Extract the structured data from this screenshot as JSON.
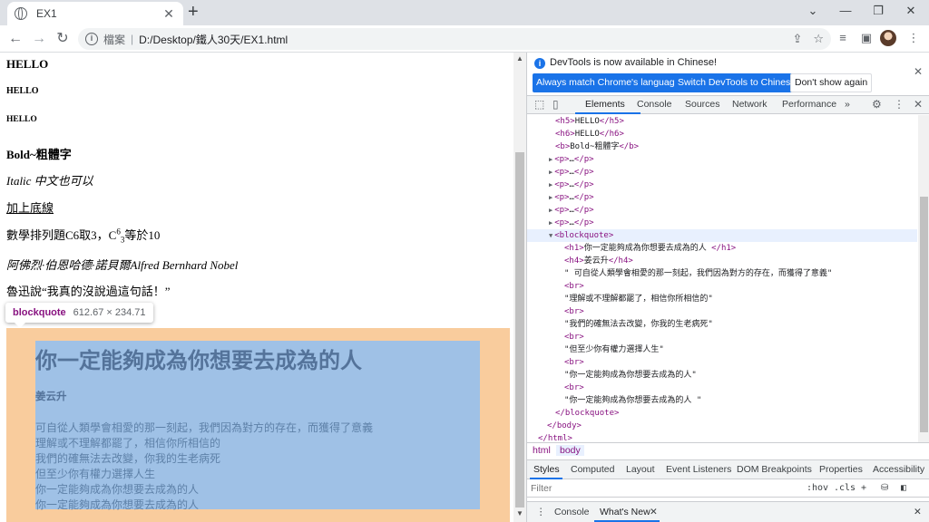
{
  "browser": {
    "tab_title": "EX1",
    "tab_close": "✕",
    "new_tab": "+",
    "window_controls": [
      "⌄",
      "—",
      "❐",
      "✕"
    ],
    "nav": {
      "back": "←",
      "forward": "→",
      "reload": "↻"
    },
    "scheme_label": "檔案",
    "url": "D:/Desktop/鐵人30天/EX1.html",
    "icons": [
      "share-icon",
      "star-icon",
      "reading-list-icon",
      "side-panel-icon",
      "profile-avatar",
      "menu-icon"
    ]
  },
  "page": {
    "h5": "HELLO",
    "h6a": "HELLO",
    "h6b": "HELLO",
    "bold": "Bold~粗體字",
    "italic": "Italic 中文也可以",
    "underline": "加上底線",
    "math": {
      "prefix": "數學排列題C6取3，C",
      "sup": "6",
      "sub": "3",
      "suffix": "等於10"
    },
    "names": "阿佛烈·伯恩哈德·諾貝爾Alfred Bernhard Nobel",
    "quote": "魯迅說“我真的沒說過這句話！”",
    "tooltip": {
      "tag": "blockquote",
      "dims": "612.67 × 234.71"
    },
    "blockquote": {
      "h1": "你一定能夠成為你想要去成為的人",
      "h4": "姜云升",
      "lines": [
        "可自從人類學會相愛的那一刻起，我們因為對方的存在，而獲得了意義",
        "理解或不理解都罷了，相信你所相信的",
        "我們的確無法去改變，你我的生老病死",
        "但至少你有權力選擇人生",
        "你一定能夠成為你想要去成為的人",
        "你一定能夠成為你想要去成為的人"
      ]
    },
    "scroll": {
      "up": "▲",
      "down": "▼"
    }
  },
  "devtools": {
    "infobar": {
      "message": "DevTools is now available in Chinese!",
      "btn_match": "Always match Chrome's language",
      "btn_switch": "Switch DevTools to Chinese",
      "btn_dismiss": "Don't show again",
      "close": "✕"
    },
    "tabs": [
      "Elements",
      "Console",
      "Sources",
      "Network",
      "Performance",
      "»"
    ],
    "elements": [
      {
        "tags": "<h5>",
        "text": "HELLO",
        "end": "</h5>"
      },
      {
        "tags": "<h6>",
        "text": "HELLO",
        "end": "</h6>"
      },
      {
        "tags": "<b>",
        "text": "Bold~粗體字",
        "end": "</b>"
      },
      {
        "tags": "<p>",
        "text": "…",
        "end": "</p>"
      },
      {
        "tags": "<p>",
        "text": "…",
        "end": "</p>"
      },
      {
        "tags": "<p>",
        "text": "…",
        "end": "</p>"
      },
      {
        "tags": "<p>",
        "text": "…",
        "end": "</p>"
      },
      {
        "tags": "<p>",
        "text": "…",
        "end": "</p>"
      },
      {
        "tags": "<p>",
        "text": "…",
        "end": "</p>"
      },
      {
        "tags": "<blockquote>",
        "text": "",
        "end": ""
      },
      {
        "tags": "<h1>",
        "text": "你一定能夠成為你想要去成為的人 ",
        "end": "</h1>"
      },
      {
        "tags": "<h4>",
        "text": "姜云升",
        "end": "</h4>"
      },
      {
        "tags": "",
        "text": "\" 可自從人類學會相愛的那一刻起，我們因為對方的存在，而獲得了意義\"",
        "end": ""
      },
      {
        "tags": "<br>",
        "text": "",
        "end": ""
      },
      {
        "tags": "",
        "text": "\"理解或不理解都罷了，相信你所相信的\"",
        "end": ""
      },
      {
        "tags": "<br>",
        "text": "",
        "end": ""
      },
      {
        "tags": "",
        "text": "\"我們的確無法去改變，你我的生老病死\"",
        "end": ""
      },
      {
        "tags": "<br>",
        "text": "",
        "end": ""
      },
      {
        "tags": "",
        "text": "\"但至少你有權力選擇人生\"",
        "end": ""
      },
      {
        "tags": "<br>",
        "text": "",
        "end": ""
      },
      {
        "tags": "",
        "text": "\"你一定能夠成為你想要去成為的人\"",
        "end": ""
      },
      {
        "tags": "<br>",
        "text": "",
        "end": ""
      },
      {
        "tags": "",
        "text": "\"你一定能夠成為你想要去成為的人 \"",
        "end": ""
      },
      {
        "tags": "</blockquote>",
        "text": "",
        "end": ""
      },
      {
        "tags": "</body>",
        "text": "",
        "end": ""
      },
      {
        "tags": "</html>",
        "text": "",
        "end": ""
      }
    ],
    "breadcrumbs": [
      "html",
      "body"
    ],
    "style_tabs": [
      "Styles",
      "Computed",
      "Layout",
      "Event Listeners",
      "DOM Breakpoints",
      "Properties",
      "Accessibility"
    ],
    "filter_placeholder": "Filter",
    "filter_hov": ":hov",
    "filter_cls": ".cls",
    "filter_plus": "+",
    "drawer_tabs": [
      "Console",
      "What's New"
    ],
    "drawer_close": "✕",
    "drawer_menu": "⋮"
  },
  "colors": {
    "tag": "#881280",
    "accent": "#1a73e8",
    "margin_overlay": "#f9cc9d",
    "content_overlay": "#9fc1e6"
  }
}
